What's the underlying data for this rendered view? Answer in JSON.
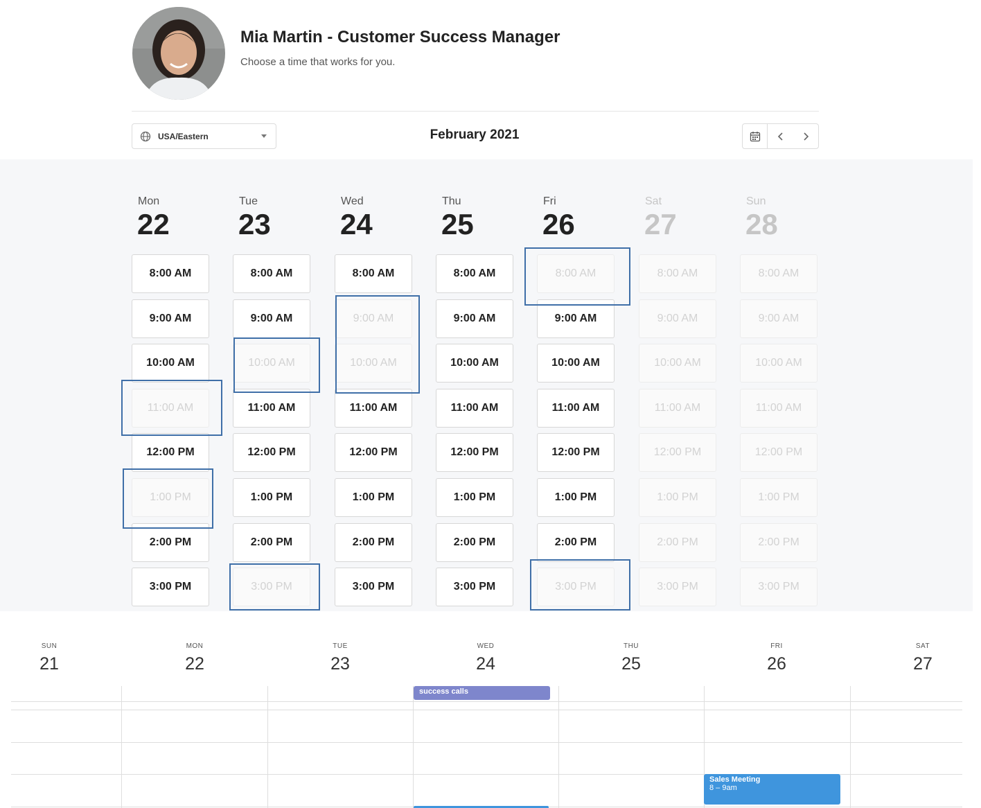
{
  "header": {
    "host_name": "Mia Martin - Customer Success Manager",
    "tagline": "Choose a time that works for you."
  },
  "controls": {
    "timezone": "USA/Eastern",
    "month": "February 2021"
  },
  "slot_grid": {
    "days": [
      {
        "dow": "Mon",
        "date": "22",
        "available": true,
        "slots": [
          {
            "t": "8:00 AM",
            "a": true
          },
          {
            "t": "9:00 AM",
            "a": true
          },
          {
            "t": "10:00 AM",
            "a": true
          },
          {
            "t": "11:00 AM",
            "a": false
          },
          {
            "t": "12:00 PM",
            "a": true
          },
          {
            "t": "1:00 PM",
            "a": false
          },
          {
            "t": "2:00 PM",
            "a": true
          },
          {
            "t": "3:00 PM",
            "a": true
          }
        ]
      },
      {
        "dow": "Tue",
        "date": "23",
        "available": true,
        "slots": [
          {
            "t": "8:00 AM",
            "a": true
          },
          {
            "t": "9:00 AM",
            "a": true
          },
          {
            "t": "10:00 AM",
            "a": false
          },
          {
            "t": "11:00 AM",
            "a": true
          },
          {
            "t": "12:00 PM",
            "a": true
          },
          {
            "t": "1:00 PM",
            "a": true
          },
          {
            "t": "2:00 PM",
            "a": true
          },
          {
            "t": "3:00 PM",
            "a": false
          }
        ]
      },
      {
        "dow": "Wed",
        "date": "24",
        "available": true,
        "slots": [
          {
            "t": "8:00 AM",
            "a": true
          },
          {
            "t": "9:00 AM",
            "a": false
          },
          {
            "t": "10:00 AM",
            "a": false
          },
          {
            "t": "11:00 AM",
            "a": true
          },
          {
            "t": "12:00 PM",
            "a": true
          },
          {
            "t": "1:00 PM",
            "a": true
          },
          {
            "t": "2:00 PM",
            "a": true
          },
          {
            "t": "3:00 PM",
            "a": true
          }
        ]
      },
      {
        "dow": "Thu",
        "date": "25",
        "available": true,
        "slots": [
          {
            "t": "8:00 AM",
            "a": true
          },
          {
            "t": "9:00 AM",
            "a": true
          },
          {
            "t": "10:00 AM",
            "a": true
          },
          {
            "t": "11:00 AM",
            "a": true
          },
          {
            "t": "12:00 PM",
            "a": true
          },
          {
            "t": "1:00 PM",
            "a": true
          },
          {
            "t": "2:00 PM",
            "a": true
          },
          {
            "t": "3:00 PM",
            "a": true
          }
        ]
      },
      {
        "dow": "Fri",
        "date": "26",
        "available": true,
        "slots": [
          {
            "t": "8:00 AM",
            "a": false
          },
          {
            "t": "9:00 AM",
            "a": true
          },
          {
            "t": "10:00 AM",
            "a": true
          },
          {
            "t": "11:00 AM",
            "a": true
          },
          {
            "t": "12:00 PM",
            "a": true
          },
          {
            "t": "1:00 PM",
            "a": true
          },
          {
            "t": "2:00 PM",
            "a": true
          },
          {
            "t": "3:00 PM",
            "a": false
          }
        ]
      },
      {
        "dow": "Sat",
        "date": "27",
        "available": false,
        "slots": [
          {
            "t": "8:00 AM",
            "a": false
          },
          {
            "t": "9:00 AM",
            "a": false
          },
          {
            "t": "10:00 AM",
            "a": false
          },
          {
            "t": "11:00 AM",
            "a": false
          },
          {
            "t": "12:00 PM",
            "a": false
          },
          {
            "t": "1:00 PM",
            "a": false
          },
          {
            "t": "2:00 PM",
            "a": false
          },
          {
            "t": "3:00 PM",
            "a": false
          }
        ]
      },
      {
        "dow": "Sun",
        "date": "28",
        "available": false,
        "slots": [
          {
            "t": "8:00 AM",
            "a": false
          },
          {
            "t": "9:00 AM",
            "a": false
          },
          {
            "t": "10:00 AM",
            "a": false
          },
          {
            "t": "11:00 AM",
            "a": false
          },
          {
            "t": "12:00 PM",
            "a": false
          },
          {
            "t": "1:00 PM",
            "a": false
          },
          {
            "t": "2:00 PM",
            "a": false
          },
          {
            "t": "3:00 PM",
            "a": false
          }
        ]
      }
    ]
  },
  "calendar": {
    "days": [
      {
        "dow": "SUN",
        "date": "21"
      },
      {
        "dow": "MON",
        "date": "22"
      },
      {
        "dow": "TUE",
        "date": "23"
      },
      {
        "dow": "WED",
        "date": "24"
      },
      {
        "dow": "THU",
        "date": "25"
      },
      {
        "dow": "FRI",
        "date": "26"
      },
      {
        "dow": "SAT",
        "date": "27"
      }
    ],
    "events": [
      {
        "title": "success calls",
        "time": "",
        "day": "WED",
        "color": "#7e86cc"
      },
      {
        "title": "Sales Meeting",
        "time": "8 – 9am",
        "day": "FRI",
        "color": "#3f95dd"
      }
    ]
  },
  "colors": {
    "highlight_border": "#3f6fa8",
    "panel_background": "#f6f7f9"
  }
}
